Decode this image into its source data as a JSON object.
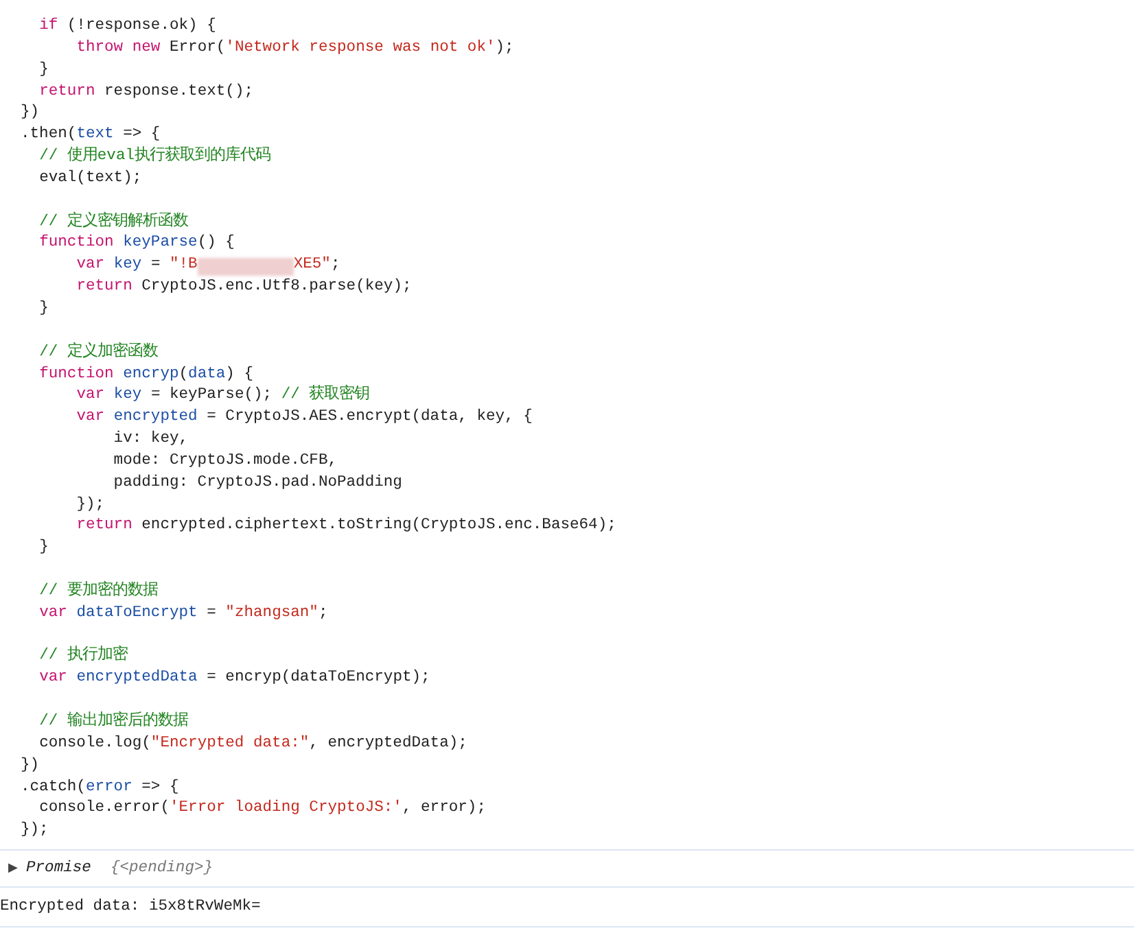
{
  "code_lines": [
    {
      "tokens": [
        {
          "text": "  if",
          "kind": "keyword"
        },
        {
          "text": " (!response.ok) {",
          "kind": "plain"
        }
      ]
    },
    {
      "tokens": [
        {
          "text": "      throw new",
          "kind": "keyword"
        },
        {
          "text": " Error(",
          "kind": "plain"
        },
        {
          "text": "'Network response was not ok'",
          "kind": "string"
        },
        {
          "text": ");",
          "kind": "plain"
        }
      ]
    },
    {
      "tokens": [
        {
          "text": "  }",
          "kind": "plain"
        }
      ]
    },
    {
      "tokens": [
        {
          "text": "  return",
          "kind": "keyword"
        },
        {
          "text": " response.text();",
          "kind": "plain"
        }
      ]
    },
    {
      "tokens": [
        {
          "text": "})",
          "kind": "plain"
        }
      ]
    },
    {
      "tokens": [
        {
          "text": ".then(",
          "kind": "plain"
        },
        {
          "text": "text",
          "kind": "name"
        },
        {
          "text": " => {",
          "kind": "plain"
        }
      ]
    },
    {
      "tokens": [
        {
          "text": "  // 使用eval执行获取到的库代码",
          "kind": "comment"
        }
      ]
    },
    {
      "tokens": [
        {
          "text": "  eval(text);",
          "kind": "plain"
        }
      ]
    },
    {
      "kind": "blank"
    },
    {
      "tokens": [
        {
          "text": "  // 定义密钥解析函数",
          "kind": "comment"
        }
      ]
    },
    {
      "tokens": [
        {
          "text": "  function ",
          "kind": "keyword"
        },
        {
          "text": "keyParse",
          "kind": "name"
        },
        {
          "text": "() {",
          "kind": "plain"
        }
      ]
    },
    {
      "tokens": [
        {
          "text": "      var ",
          "kind": "keyword"
        },
        {
          "text": "key",
          "kind": "name"
        },
        {
          "text": " = ",
          "kind": "plain"
        },
        {
          "text": "\"!B",
          "kind": "string"
        },
        {
          "kind": "redacted"
        },
        {
          "text": "XE5\"",
          "kind": "string"
        },
        {
          "text": ";",
          "kind": "plain"
        }
      ]
    },
    {
      "tokens": [
        {
          "text": "      return",
          "kind": "keyword"
        },
        {
          "text": " CryptoJS.enc.Utf8.parse(key);",
          "kind": "plain"
        }
      ]
    },
    {
      "tokens": [
        {
          "text": "  }",
          "kind": "plain"
        }
      ]
    },
    {
      "kind": "blank"
    },
    {
      "tokens": [
        {
          "text": "  // 定义加密函数",
          "kind": "comment"
        }
      ]
    },
    {
      "tokens": [
        {
          "text": "  function ",
          "kind": "keyword"
        },
        {
          "text": "encryp",
          "kind": "name"
        },
        {
          "text": "(",
          "kind": "plain"
        },
        {
          "text": "data",
          "kind": "name"
        },
        {
          "text": ") {",
          "kind": "plain"
        }
      ]
    },
    {
      "tokens": [
        {
          "text": "      var ",
          "kind": "keyword"
        },
        {
          "text": "key",
          "kind": "name"
        },
        {
          "text": " = keyParse(); ",
          "kind": "plain"
        },
        {
          "text": "// 获取密钥",
          "kind": "comment"
        }
      ]
    },
    {
      "tokens": [
        {
          "text": "      var ",
          "kind": "keyword"
        },
        {
          "text": "encrypted",
          "kind": "name"
        },
        {
          "text": " = CryptoJS.AES.encrypt(data, key, {",
          "kind": "plain"
        }
      ]
    },
    {
      "tokens": [
        {
          "text": "          iv: key,",
          "kind": "plain"
        }
      ]
    },
    {
      "tokens": [
        {
          "text": "          mode: CryptoJS.mode.CFB,",
          "kind": "plain"
        }
      ]
    },
    {
      "tokens": [
        {
          "text": "          padding: CryptoJS.pad.NoPadding",
          "kind": "plain"
        }
      ]
    },
    {
      "tokens": [
        {
          "text": "      });",
          "kind": "plain"
        }
      ]
    },
    {
      "tokens": [
        {
          "text": "      return",
          "kind": "keyword"
        },
        {
          "text": " encrypted.ciphertext.toString(CryptoJS.enc.Base64);",
          "kind": "plain"
        }
      ]
    },
    {
      "tokens": [
        {
          "text": "  }",
          "kind": "plain"
        }
      ]
    },
    {
      "kind": "blank"
    },
    {
      "tokens": [
        {
          "text": "  // 要加密的数据",
          "kind": "comment"
        }
      ]
    },
    {
      "tokens": [
        {
          "text": "  var ",
          "kind": "keyword"
        },
        {
          "text": "dataToEncrypt",
          "kind": "name"
        },
        {
          "text": " = ",
          "kind": "plain"
        },
        {
          "text": "\"zhangsan\"",
          "kind": "string"
        },
        {
          "text": ";",
          "kind": "plain"
        }
      ]
    },
    {
      "kind": "blank"
    },
    {
      "tokens": [
        {
          "text": "  // 执行加密",
          "kind": "comment"
        }
      ]
    },
    {
      "tokens": [
        {
          "text": "  var ",
          "kind": "keyword"
        },
        {
          "text": "encryptedData",
          "kind": "name"
        },
        {
          "text": " = encryp(dataToEncrypt);",
          "kind": "plain"
        }
      ]
    },
    {
      "kind": "blank"
    },
    {
      "tokens": [
        {
          "text": "  // 输出加密后的数据",
          "kind": "comment"
        }
      ]
    },
    {
      "tokens": [
        {
          "text": "  console.log(",
          "kind": "plain"
        },
        {
          "text": "\"Encrypted data:\"",
          "kind": "string"
        },
        {
          "text": ", encryptedData);",
          "kind": "plain"
        }
      ]
    },
    {
      "tokens": [
        {
          "text": "})",
          "kind": "plain"
        }
      ]
    },
    {
      "tokens": [
        {
          "text": ".catch(",
          "kind": "plain"
        },
        {
          "text": "error",
          "kind": "name"
        },
        {
          "text": " => {",
          "kind": "plain"
        }
      ]
    },
    {
      "tokens": [
        {
          "text": "  console.error(",
          "kind": "plain"
        },
        {
          "text": "'Error loading CryptoJS:'",
          "kind": "string"
        },
        {
          "text": ", error);",
          "kind": "plain"
        }
      ]
    },
    {
      "tokens": [
        {
          "text": "});",
          "kind": "plain"
        }
      ]
    }
  ],
  "result": {
    "expand_glyph": "▶",
    "type": "Promise",
    "value": "{<pending>}"
  },
  "log_output": "Encrypted data: i5x8tRvWeMk="
}
